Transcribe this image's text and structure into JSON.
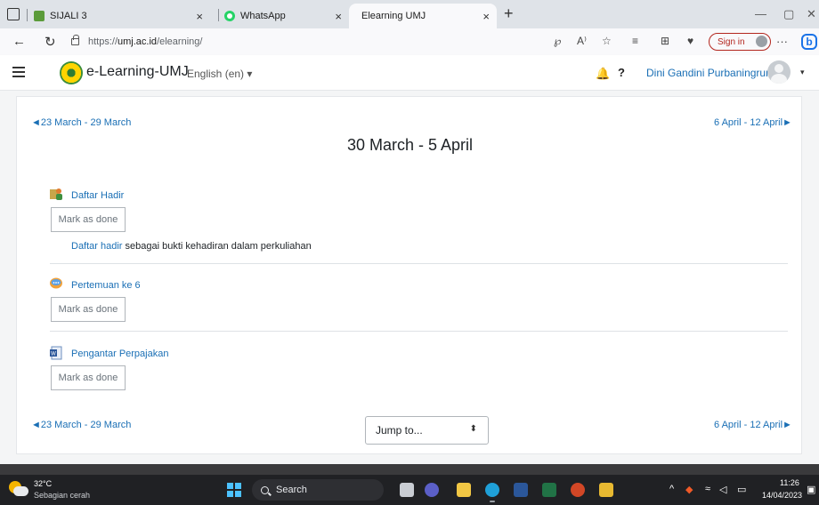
{
  "browser": {
    "tabs": [
      {
        "title": "SIJALI 3",
        "close": "×"
      },
      {
        "title": "WhatsApp",
        "close": "×"
      },
      {
        "title": "Elearning UMJ",
        "close": "×"
      }
    ],
    "new_tab": "+",
    "window_minimize": "—",
    "window_restore": "▢",
    "window_close": "✕",
    "back": "←",
    "refresh": "↻",
    "url_scheme": "https://",
    "url_host": "umj.ac.id",
    "url_path": "/elearning/",
    "signin_label": "Sign in",
    "more": "···",
    "bing": "b"
  },
  "navbar": {
    "site_name": "e-Learning-UMJ",
    "language": "English (en) ▾",
    "bell": "🔔",
    "help": "?",
    "user_name": "Dini Gandini Purbaningrum",
    "caret": "▾"
  },
  "course": {
    "prev_week": "◄23 March - 29 March",
    "next_week": "6 April - 12 April►",
    "week_title": "30 March - 5 April",
    "jump_to": "Jump to...",
    "jump_arrows": "⬍",
    "activities": [
      {
        "name": "Daftar Hadir",
        "button": "Mark as done",
        "description_link": "Daftar hadir",
        "description_rest": " sebagai bukti kehadiran dalam perkuliahan"
      },
      {
        "name": "Pertemuan ke 6",
        "button": "Mark as done"
      },
      {
        "name": "Pengantar Perpajakan",
        "button": "Mark as done"
      }
    ]
  },
  "taskbar": {
    "temperature": "32°C",
    "weather": "Sebagian cerah",
    "search": "Search",
    "tray_chevron": "^",
    "time": "11:26",
    "date": "14/04/2023"
  },
  "colors": {
    "link": "#1a6fb5",
    "signin": "#b3261e",
    "taskbar": "#202124"
  }
}
